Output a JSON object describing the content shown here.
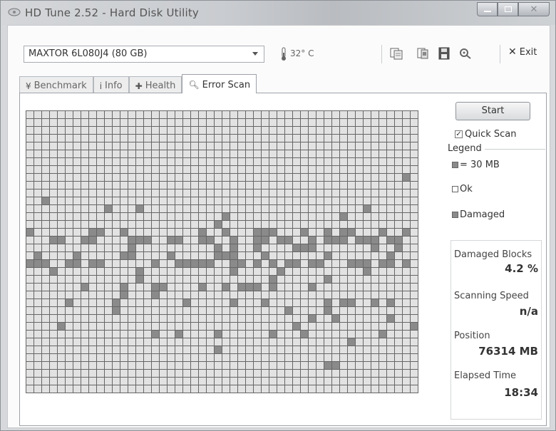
{
  "window": {
    "title": "HD Tune 2.52 - Hard Disk Utility"
  },
  "toolbar": {
    "drive": "MAXTOR 6L080J4 (80 GB)",
    "temperature": "32° C",
    "exit_label": "Exit"
  },
  "tabs": [
    {
      "label": "Benchmark",
      "icon": "benchmark-icon"
    },
    {
      "label": "Info",
      "icon": "info-icon"
    },
    {
      "label": "Health",
      "icon": "health-icon"
    },
    {
      "label": "Error Scan",
      "icon": "magnifier-icon",
      "active": true
    }
  ],
  "scan": {
    "start_label": "Start",
    "quick_scan_label": "Quick Scan",
    "quick_scan_checked": true,
    "legend_title": "Legend",
    "legend_block": "= 30 MB",
    "legend_ok": "Ok",
    "legend_damaged": "Damaged"
  },
  "stats": {
    "damaged_blocks_label": "Damaged Blocks",
    "damaged_blocks_value": "4.2 %",
    "scanning_speed_label": "Scanning Speed",
    "scanning_speed_value": "n/a",
    "position_label": "Position",
    "position_value": "76314 MB",
    "elapsed_time_label": "Elapsed Time",
    "elapsed_time_value": "18:34"
  },
  "grid": {
    "columns": 50,
    "rows": 36,
    "damaged_cells": [
      [
        8,
        48
      ],
      [
        11,
        2
      ],
      [
        12,
        10
      ],
      [
        12,
        14
      ],
      [
        12,
        43
      ],
      [
        13,
        25
      ],
      [
        13,
        40
      ],
      [
        14,
        24
      ],
      [
        15,
        0
      ],
      [
        15,
        8
      ],
      [
        15,
        9
      ],
      [
        15,
        12
      ],
      [
        15,
        22
      ],
      [
        15,
        25
      ],
      [
        15,
        29
      ],
      [
        15,
        30
      ],
      [
        15,
        31
      ],
      [
        15,
        35
      ],
      [
        15,
        38
      ],
      [
        15,
        40
      ],
      [
        15,
        41
      ],
      [
        15,
        45
      ],
      [
        15,
        48
      ],
      [
        16,
        3
      ],
      [
        16,
        4
      ],
      [
        16,
        7
      ],
      [
        16,
        8
      ],
      [
        16,
        13
      ],
      [
        16,
        14
      ],
      [
        16,
        15
      ],
      [
        16,
        18
      ],
      [
        16,
        19
      ],
      [
        16,
        22
      ],
      [
        16,
        23
      ],
      [
        16,
        26
      ],
      [
        16,
        29
      ],
      [
        16,
        30
      ],
      [
        16,
        32
      ],
      [
        16,
        33
      ],
      [
        16,
        36
      ],
      [
        16,
        38
      ],
      [
        16,
        39
      ],
      [
        16,
        40
      ],
      [
        16,
        42
      ],
      [
        16,
        43
      ],
      [
        16,
        44
      ],
      [
        16,
        46
      ],
      [
        16,
        47
      ],
      [
        17,
        13
      ],
      [
        17,
        24
      ],
      [
        17,
        26
      ],
      [
        17,
        29
      ],
      [
        17,
        34
      ],
      [
        17,
        35
      ],
      [
        17,
        36
      ],
      [
        17,
        44
      ],
      [
        17,
        47
      ],
      [
        18,
        1
      ],
      [
        18,
        6
      ],
      [
        18,
        12
      ],
      [
        18,
        13
      ],
      [
        18,
        18
      ],
      [
        18,
        24
      ],
      [
        18,
        25
      ],
      [
        18,
        26
      ],
      [
        18,
        30
      ],
      [
        18,
        38
      ],
      [
        18,
        46
      ],
      [
        19,
        0
      ],
      [
        19,
        1
      ],
      [
        19,
        2
      ],
      [
        19,
        5
      ],
      [
        19,
        6
      ],
      [
        19,
        8
      ],
      [
        19,
        9
      ],
      [
        19,
        16
      ],
      [
        19,
        19
      ],
      [
        19,
        20
      ],
      [
        19,
        21
      ],
      [
        19,
        22
      ],
      [
        19,
        23
      ],
      [
        19,
        26
      ],
      [
        19,
        27
      ],
      [
        19,
        29
      ],
      [
        19,
        31
      ],
      [
        19,
        33
      ],
      [
        19,
        34
      ],
      [
        19,
        36
      ],
      [
        19,
        37
      ],
      [
        19,
        41
      ],
      [
        19,
        42
      ],
      [
        19,
        43
      ],
      [
        19,
        45
      ],
      [
        19,
        46
      ],
      [
        19,
        48
      ],
      [
        20,
        3
      ],
      [
        20,
        14
      ],
      [
        20,
        26
      ],
      [
        20,
        32
      ],
      [
        20,
        43
      ],
      [
        21,
        14
      ],
      [
        21,
        31
      ],
      [
        21,
        38
      ],
      [
        22,
        7
      ],
      [
        22,
        12
      ],
      [
        22,
        16
      ],
      [
        22,
        17
      ],
      [
        22,
        22
      ],
      [
        22,
        25
      ],
      [
        22,
        27
      ],
      [
        22,
        28
      ],
      [
        22,
        29
      ],
      [
        22,
        31
      ],
      [
        22,
        36
      ],
      [
        23,
        12
      ],
      [
        23,
        16
      ],
      [
        24,
        5
      ],
      [
        24,
        11
      ],
      [
        24,
        20
      ],
      [
        24,
        26
      ],
      [
        24,
        30
      ],
      [
        24,
        38
      ],
      [
        24,
        40
      ],
      [
        24,
        41
      ],
      [
        24,
        44
      ],
      [
        24,
        46
      ],
      [
        25,
        11
      ],
      [
        25,
        33
      ],
      [
        25,
        38
      ],
      [
        26,
        36
      ],
      [
        26,
        39
      ],
      [
        26,
        46
      ],
      [
        27,
        4
      ],
      [
        27,
        34
      ],
      [
        27,
        49
      ],
      [
        28,
        16
      ],
      [
        28,
        19
      ],
      [
        28,
        24
      ],
      [
        28,
        31
      ],
      [
        28,
        35
      ],
      [
        28,
        45
      ],
      [
        29,
        41
      ],
      [
        30,
        24
      ],
      [
        32,
        38
      ],
      [
        32,
        39
      ]
    ]
  }
}
